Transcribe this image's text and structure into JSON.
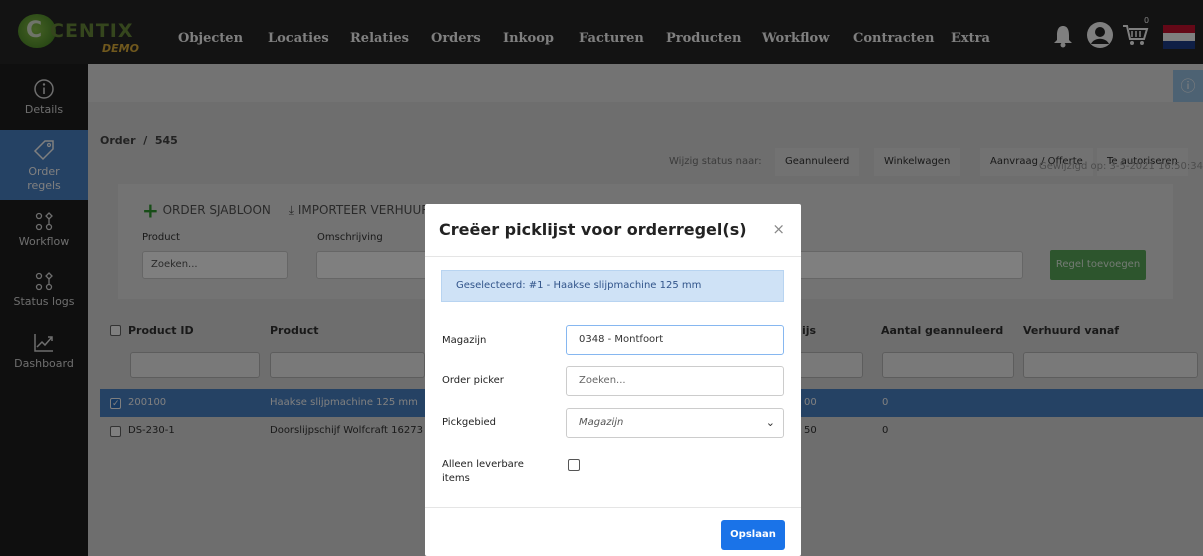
{
  "logo": {
    "word": "CENTIX",
    "sub": "DEMO"
  },
  "nav": [
    "Objecten",
    "Locaties",
    "Relaties",
    "Orders",
    "Inkoop",
    "Facturen",
    "Producten",
    "Workflow",
    "Contracten",
    "Extra"
  ],
  "cart_count": "0",
  "sidebar": [
    "Details",
    "Order regels",
    "Workflow",
    "Status logs",
    "Dashboard"
  ],
  "breadcrumb": "Order  /  545",
  "status": {
    "label": "Wijzig status naar:",
    "buttons": [
      "Geannuleerd",
      "Winkelwagen",
      "Aanvraag / Offerte",
      "Te autoriseren"
    ]
  },
  "modified": "Gewijzigd op: 3-5-2021 16:50:34",
  "panel": {
    "sjabloon": "ORDER SJABLOON",
    "importeer": "IMPORTEER VERHUURDE OBJECTEN",
    "product_label": "Product",
    "omschrijving_label": "Omschrijving",
    "product_placeholder": "Zoeken...",
    "add_button": "Regel toevoegen"
  },
  "table": {
    "headers": [
      "Product ID",
      "Product",
      "ijs",
      "Aantal geannuleerd",
      "Verhuurd vanaf"
    ],
    "rows": [
      {
        "checked": true,
        "id": "200100",
        "product": "Haakse slijpmachine 125 mm",
        "prijs": "00",
        "geannuleerd": "0"
      },
      {
        "checked": false,
        "id": "DS-230-1",
        "product": "Doorslijpschijf Wolfcraft 16273",
        "prijs": "50",
        "geannuleerd": "0"
      }
    ]
  },
  "modal": {
    "title": "Creëer picklijst voor orderregel(s)",
    "close": "×",
    "selected": "Geselecteerd: #1 - Haakse slijpmachine 125 mm",
    "magazijn_label": "Magazijn",
    "magazijn_value": "0348 - Montfoort",
    "picker_label": "Order picker",
    "picker_placeholder": "Zoeken...",
    "pickgebied_label": "Pickgebied",
    "pickgebied_value": "Magazijn",
    "alleen_label": "Alleen leverbare items",
    "save": "Opslaan"
  }
}
